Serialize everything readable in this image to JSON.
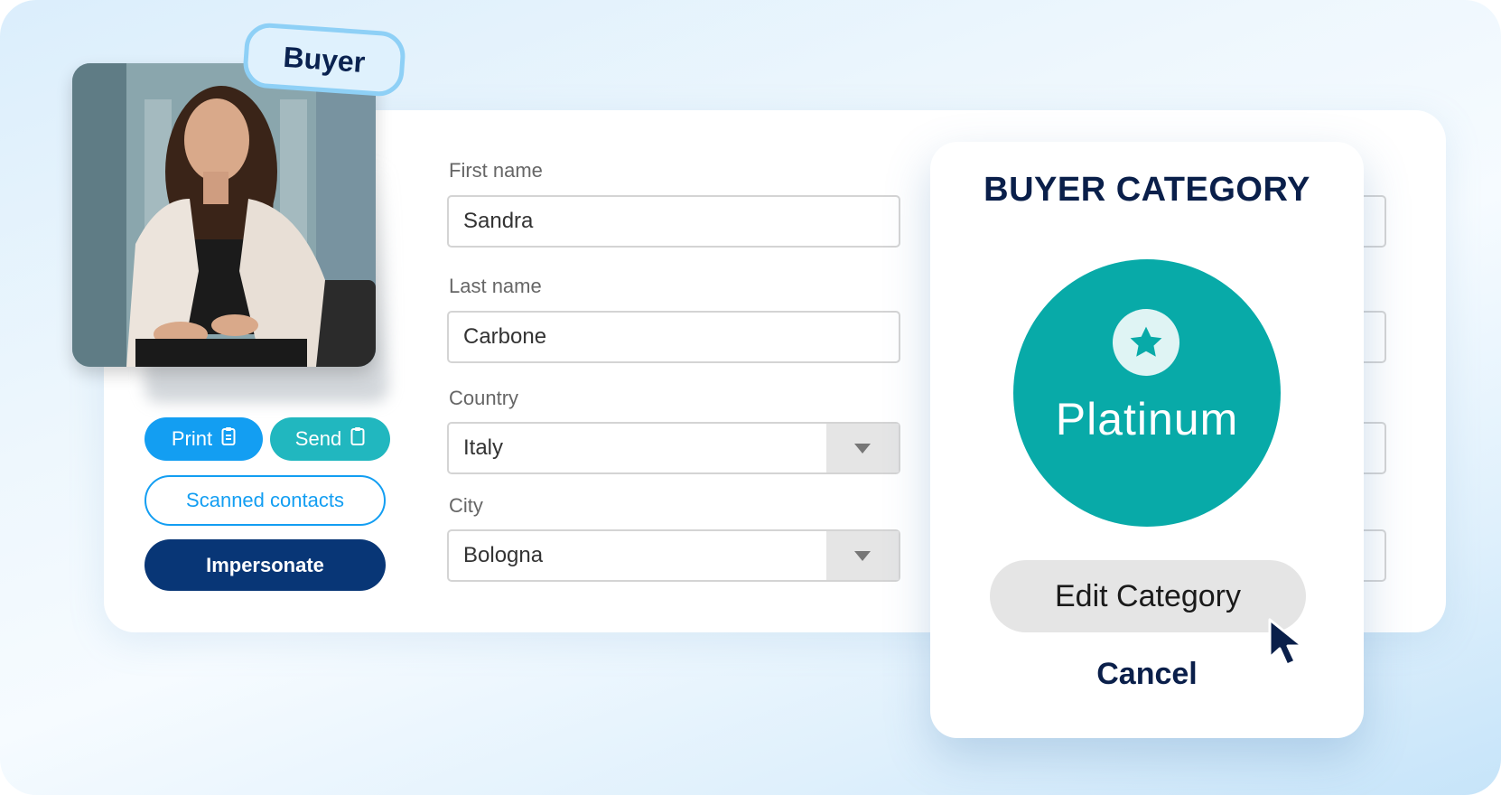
{
  "profile": {
    "role_badge": "Buyer",
    "photo_alt": "profile-photo"
  },
  "actions": {
    "print_label": "Print",
    "send_label": "Send",
    "scanned_label": "Scanned contacts",
    "impersonate_label": "Impersonate"
  },
  "form": {
    "first_name_label": "First name",
    "first_name_value": "Sandra",
    "last_name_label": "Last name",
    "last_name_value": "Carbone",
    "country_label": "Country",
    "country_value": "Italy",
    "city_label": "City",
    "city_value": "Bologna"
  },
  "modal": {
    "title": "BUYER CATEGORY",
    "tier": "Platinum",
    "tier_icon": "star-icon",
    "edit_label": "Edit Category",
    "cancel_label": "Cancel"
  },
  "colors": {
    "primary_blue": "#139ef2",
    "teal": "#21b7bf",
    "navy": "#083676",
    "tier": "#08aaa8"
  }
}
